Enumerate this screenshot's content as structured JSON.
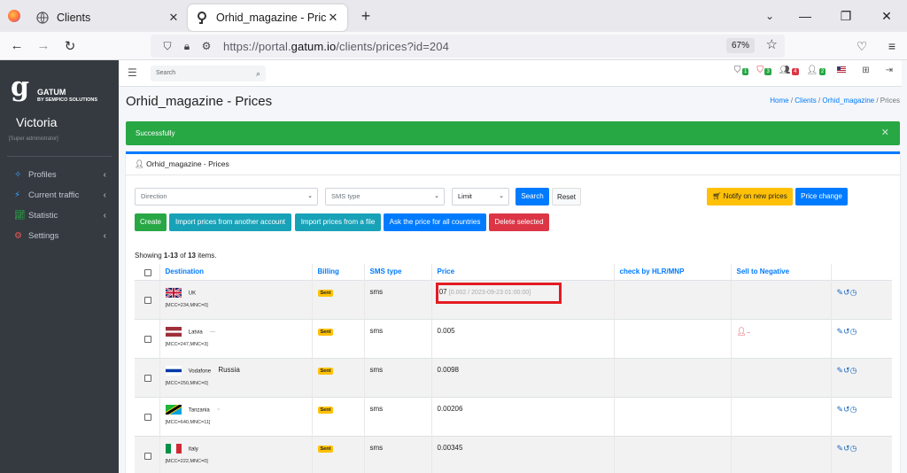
{
  "browser": {
    "tabs": [
      {
        "title": "Clients"
      },
      {
        "title": "Orhid_magazine - Prices"
      }
    ],
    "url_prefix": "https://portal.",
    "url_domain": "gatum.io",
    "url_path": "/clients/prices?id=204",
    "zoom": "67%"
  },
  "sidebar": {
    "brand_name": "GATUM",
    "brand_sub": "BY SEMPICO SOLUTIONS",
    "user": "Victoria",
    "role": "[Super administrator]",
    "items": [
      {
        "label": "Profiles"
      },
      {
        "label": "Current traffic"
      },
      {
        "label": "Statistic"
      },
      {
        "label": "Settings"
      }
    ]
  },
  "topbar": {
    "search_placeholder": "Search",
    "badges": [
      {
        "count": "1",
        "color": "#28a745"
      },
      {
        "count": "3",
        "color": "#28a745"
      },
      {
        "count": "4",
        "color": "#dc3545"
      },
      {
        "count": "2",
        "color": "#28a745"
      }
    ]
  },
  "page": {
    "title": "Orhid_magazine - Prices",
    "breadcrumb": [
      "Home",
      "Clients",
      "Orhid_magazine",
      "Prices"
    ],
    "alert": "Successfully",
    "card_title": "Orhid_magazine - Prices"
  },
  "filters": {
    "direction": "Direction",
    "sms_type": "SMS type",
    "limit": "Limit",
    "search": "Search",
    "reset": "Reset",
    "notify": "Notify on new prices",
    "price_change": "Price change"
  },
  "actions": {
    "create": "Create",
    "import_account": "Import prices from another account",
    "import_file": "Import prices from a file",
    "ask_price": "Ask the price for all countries",
    "delete_selected": "Delete selected"
  },
  "summary": {
    "prefix": "Showing ",
    "range": "1-13",
    "mid": " of ",
    "total": "13",
    "suffix": " items."
  },
  "table": {
    "headers": [
      "Destination",
      "Billing",
      "SMS type",
      "Price",
      "check by HLR/MNP",
      "Sell to Negative"
    ],
    "rows": [
      {
        "country": "UK",
        "operator": "",
        "mcc": "[MCC=234,MNC=0]",
        "billing": "Sent",
        "sms_type": "sms",
        "price": ".07",
        "price_hint": "[0.002 / 2023-09-23 01:00:00]",
        "sell_negative": false
      },
      {
        "country": "Latvia",
        "operator": "",
        "mcc": "[MCC=247,MNC=3]",
        "billing": "Sent",
        "sms_type": "sms",
        "price": "0.005",
        "price_hint": "",
        "sell_negative": true
      },
      {
        "country": "Vodafone",
        "operator": "Russia",
        "mcc": "[MCC=250,MNC=0]",
        "billing": "Sent",
        "sms_type": "sms",
        "price": "0.0098",
        "price_hint": "",
        "sell_negative": false
      },
      {
        "country": "Tanzania",
        "operator": "",
        "mcc": "[MCC=640,MNC=11]",
        "billing": "Sent",
        "sms_type": "sms",
        "price": "0.00206",
        "price_hint": "",
        "sell_negative": false
      },
      {
        "country": "Italy",
        "operator": "",
        "mcc": "[MCC=222,MNC=0]",
        "billing": "Sent",
        "sms_type": "sms",
        "price": "0.00345",
        "price_hint": "",
        "sell_negative": false
      }
    ]
  }
}
